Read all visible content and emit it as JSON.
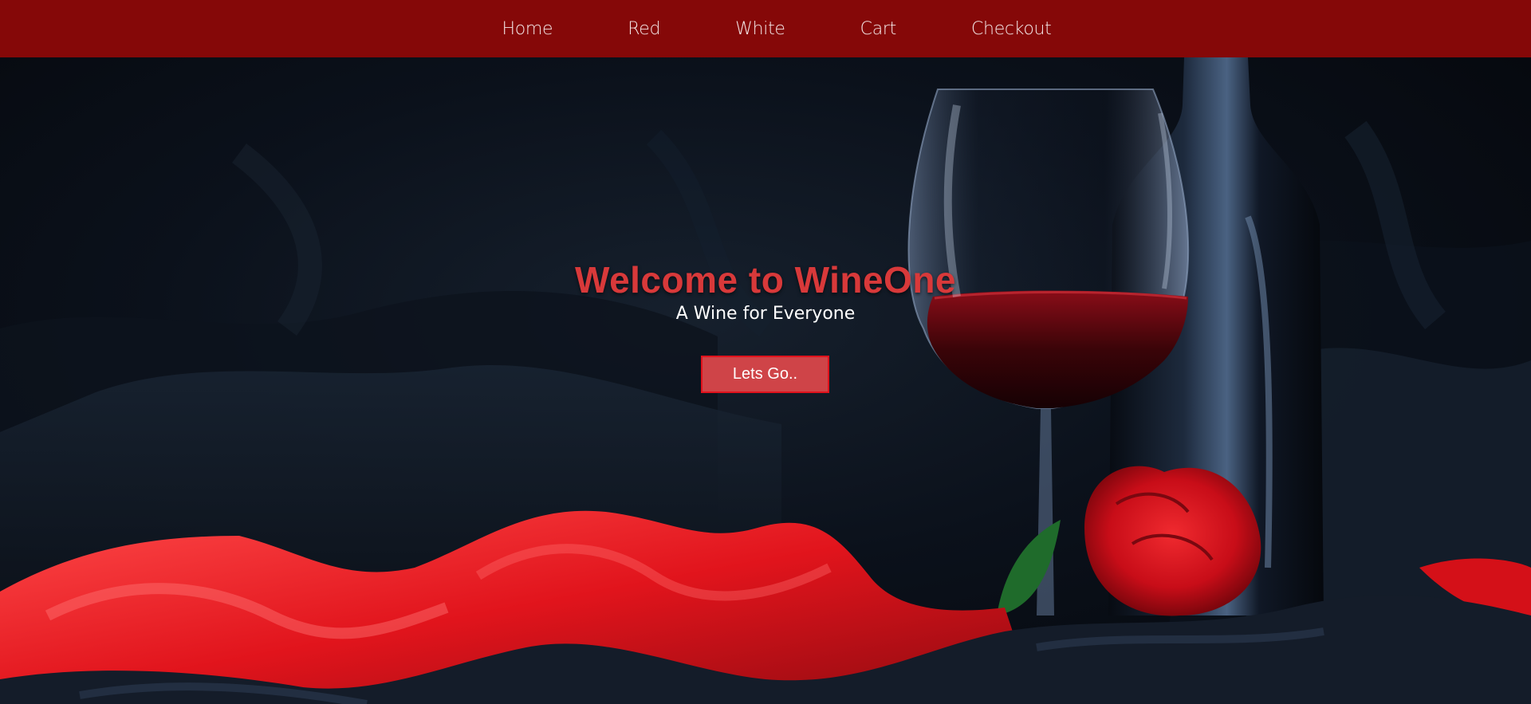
{
  "nav": {
    "items": [
      {
        "label": "Home"
      },
      {
        "label": "Red"
      },
      {
        "label": "White"
      },
      {
        "label": "Cart"
      },
      {
        "label": "Checkout"
      }
    ]
  },
  "hero": {
    "title": "Welcome to WineOne",
    "subtitle": "A Wine for Everyone",
    "cta_label": "Lets Go.."
  },
  "colors": {
    "navbar_bg": "#850808",
    "title": "#d8393a",
    "cta_bg": "#cf4448",
    "cta_border": "#e0121c"
  }
}
